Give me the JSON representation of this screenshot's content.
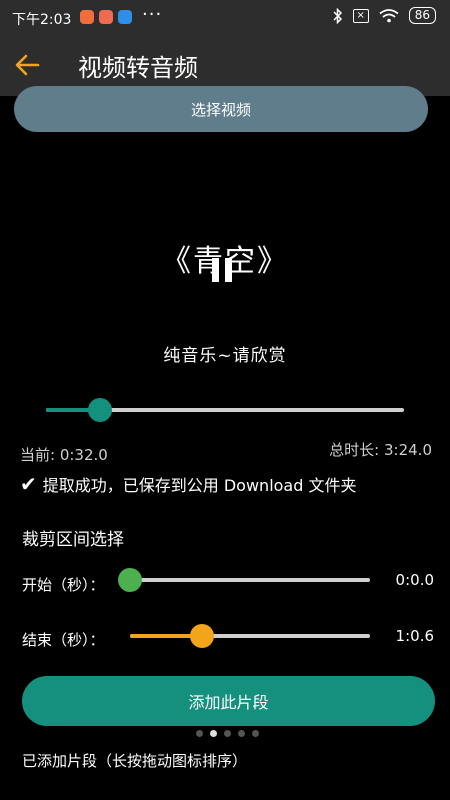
{
  "status_bar": {
    "time": "下午2:03",
    "more": "···",
    "battery": "86",
    "icons": [
      "app-icon-orange",
      "app-icon-red",
      "app-icon-blue",
      "bluetooth-icon",
      "no-sim-icon",
      "wifi-icon",
      "battery-icon"
    ]
  },
  "app_bar": {
    "title": "视频转音频",
    "back_icon": "back-arrow-icon",
    "accent": "#f2a51a"
  },
  "select_button": {
    "label": "选择视频"
  },
  "video": {
    "title": "《青空》",
    "subtitle": "纯音乐~请欣赏",
    "state": "pause-icon"
  },
  "player": {
    "progress_fraction": 0.15,
    "current_label": "当前: 0:32.0",
    "total_label": "总时长: 3:24.0",
    "track_color": "#16907e"
  },
  "status_message": {
    "check": "✔",
    "text": "提取成功，已保存到公用 Download 文件夹"
  },
  "trim": {
    "heading": "裁剪区间选择",
    "start": {
      "label": "开始（秒）：",
      "value": "0:0.0",
      "fraction": 0.0,
      "color": "#4caf50"
    },
    "end": {
      "label": "结束（秒）：",
      "value": "1:0.6",
      "fraction": 0.3,
      "color": "#f2a51a"
    }
  },
  "add_button": {
    "label": "添加此片段",
    "color": "#16907e"
  },
  "pager": {
    "count": 5,
    "active": 1
  },
  "segments": {
    "heading": "已添加片段（长按拖动图标排序）"
  }
}
